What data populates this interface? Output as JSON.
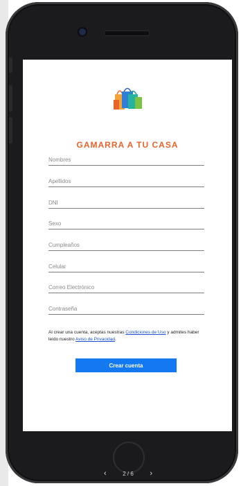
{
  "brand": {
    "name": "GAMARRA A TU CASA",
    "color": "#e8642a"
  },
  "form": {
    "fields": [
      {
        "label": "Nombres"
      },
      {
        "label": "Apellidos"
      },
      {
        "label": "DNI"
      },
      {
        "label": "Sexo"
      },
      {
        "label": "Cumpleaños"
      },
      {
        "label": "Celular"
      },
      {
        "label": "Correo Electrónico"
      },
      {
        "label": "Contraseña"
      }
    ]
  },
  "terms": {
    "prefix": "Al crear una cuenta, aceptas nuestras ",
    "link1": "Condiciones de Uso",
    "middle": " y admites haber leído nuestro ",
    "link2": "Aviso de Privacidad",
    "suffix": "."
  },
  "button": {
    "label": "Crear cuenta",
    "color": "#1479f0"
  },
  "pager": {
    "text": "2 / 6",
    "prev": "‹",
    "next": "›"
  },
  "icons": {
    "logo": "shopping-bags-icon"
  }
}
